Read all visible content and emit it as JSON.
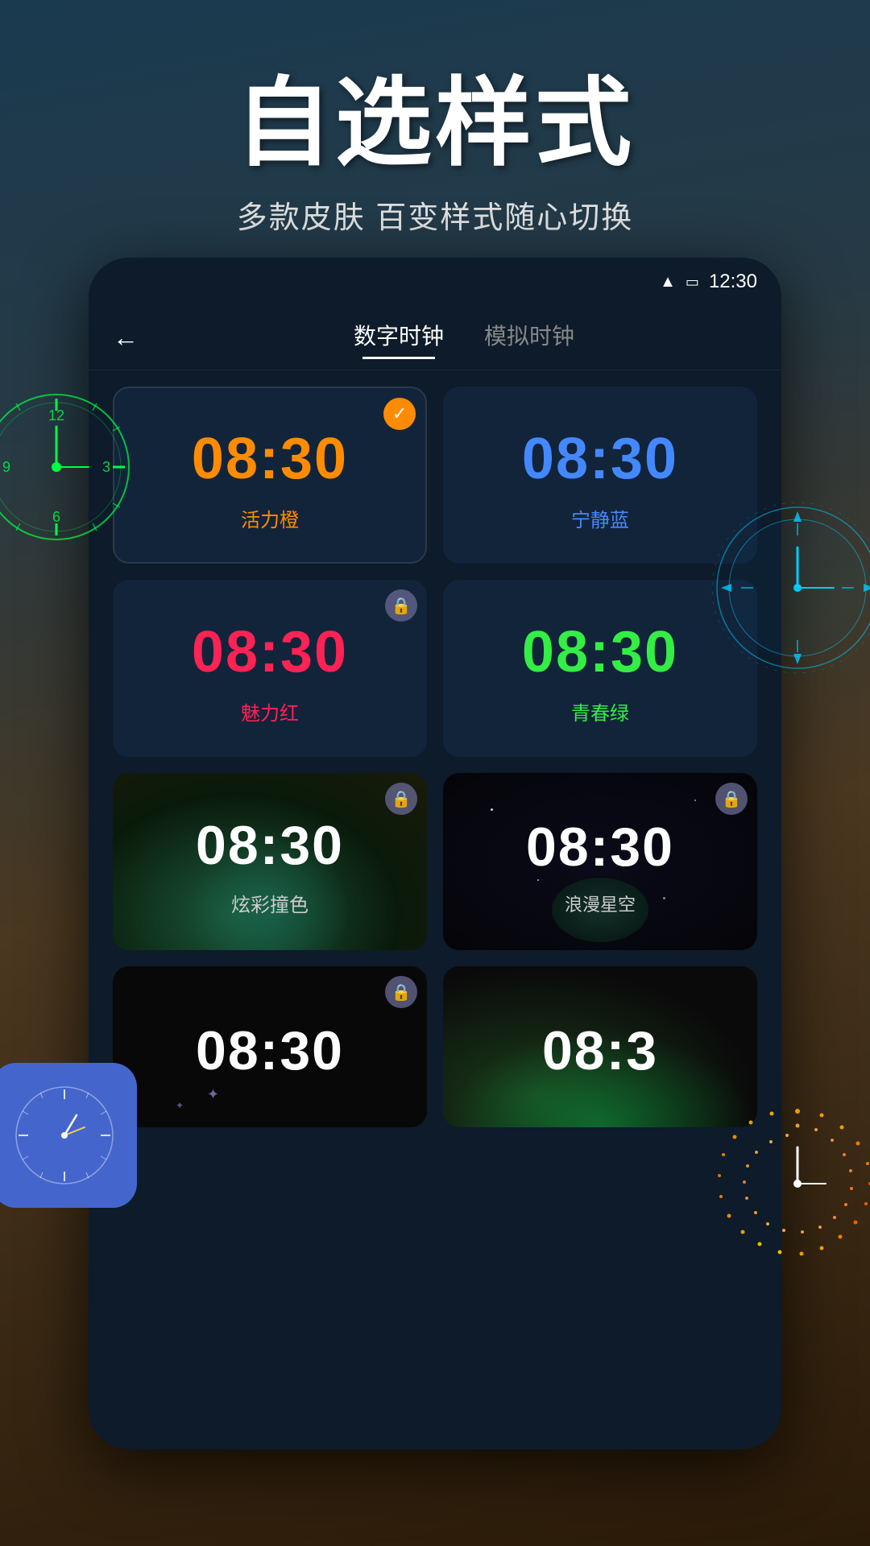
{
  "header": {
    "title": "自选样式",
    "subtitle": "多款皮肤 百变样式随心切换"
  },
  "statusBar": {
    "time": "12:30",
    "signal": "▲",
    "battery": "🔋"
  },
  "nav": {
    "back": "←",
    "tab1": "数字时钟",
    "tab2": "模拟时钟"
  },
  "clocks": [
    {
      "time": "08:30",
      "label": "活力橙",
      "color": "#ff8c00",
      "labelColor": "#ff8c00",
      "selected": true,
      "locked": false,
      "type": "plain"
    },
    {
      "time": "08:30",
      "label": "宁静蓝",
      "color": "#4488ff",
      "labelColor": "#4488ff",
      "selected": false,
      "locked": false,
      "type": "plain"
    },
    {
      "time": "08:30",
      "label": "魅力红",
      "color": "#ff2255",
      "labelColor": "#ff2255",
      "selected": false,
      "locked": true,
      "type": "plain"
    },
    {
      "time": "08:30",
      "label": "青春绿",
      "color": "#33ee44",
      "labelColor": "#33ee44",
      "selected": false,
      "locked": false,
      "type": "plain"
    },
    {
      "time": "08:30",
      "label": "炫彩撞色",
      "color": "#ffffff",
      "labelColor": "#cccccc",
      "selected": false,
      "locked": true,
      "type": "colorful"
    },
    {
      "time": "08:30",
      "label": "浪漫星空",
      "color": "#ffffff",
      "labelColor": "#cccccc",
      "selected": false,
      "locked": true,
      "type": "space"
    },
    {
      "time": "08:30",
      "label": "",
      "color": "#ffffff",
      "labelColor": "#ffffff",
      "selected": false,
      "locked": true,
      "type": "dark1"
    },
    {
      "time": "08:3",
      "label": "",
      "color": "#ffffff",
      "labelColor": "#ffffff",
      "selected": false,
      "locked": false,
      "type": "galaxy"
    }
  ]
}
